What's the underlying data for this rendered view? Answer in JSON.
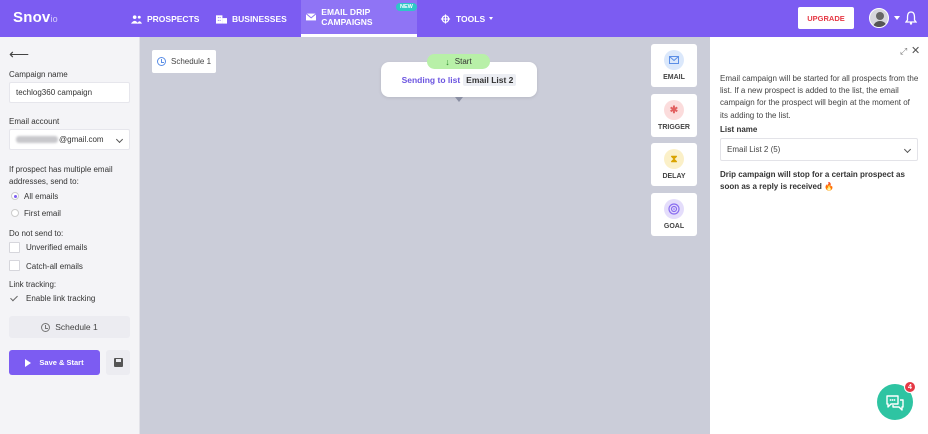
{
  "app": {
    "logo": "Snov",
    "logo_suffix": "io"
  },
  "nav": {
    "items": [
      {
        "label": "PROSPECTS",
        "icon": "people-icon"
      },
      {
        "label": "BUSINESSES",
        "icon": "building-icon"
      },
      {
        "label": "EMAIL DRIP CAMPAIGNS",
        "icon": "envelope-icon",
        "badge": "NEW",
        "active": true
      },
      {
        "label": "TOOLS",
        "icon": "crosshair-icon"
      }
    ],
    "upgrade_label": "UPGRADE"
  },
  "left": {
    "campaign_name_label": "Campaign name",
    "campaign_name_value": "techlog360 campaign",
    "email_account_label": "Email account",
    "email_account_value": "@gmail.com",
    "multiple_label_line1": "If prospect has multiple email",
    "multiple_label_line2": "addresses, send to:",
    "radio_all": "All emails",
    "radio_first": "First email",
    "do_not_send_label": "Do not send to:",
    "check_unverified": "Unverified emails",
    "check_catchall": "Catch-all emails",
    "link_tracking_label": "Link tracking:",
    "check_link_tracking": "Enable link tracking",
    "schedule_label": "Schedule 1",
    "save_start_label": "Save & Start"
  },
  "canvas": {
    "schedule_chip": "Schedule 1",
    "start_label": "Start",
    "sending_label": "Sending to list",
    "list_name": "Email List 2",
    "tools": [
      {
        "label": "EMAIL",
        "icon": "envelope-icon",
        "color": "#dbe8fb"
      },
      {
        "label": "TRIGGER",
        "icon": "trigger-icon",
        "color": "#fbdcdc"
      },
      {
        "label": "DELAY",
        "icon": "hourglass-icon",
        "color": "#fbf0c8"
      },
      {
        "label": "GOAL",
        "icon": "target-icon",
        "color": "#e4ddfb"
      }
    ]
  },
  "right": {
    "description": "Email campaign will be started for all prospects from the list. If a new prospect is added to the list, the email campaign for the prospect will begin at the moment of its adding to the list.",
    "list_name_label": "List name",
    "list_select_value": "Email List 2 (5)",
    "note": "Drip campaign will stop for a certain prospect as soon as a reply is received",
    "note_emoji": "🔥"
  },
  "chat": {
    "badge_count": "4"
  },
  "colors": {
    "brand": "#7c5cf2",
    "upgrade_text": "#e53945",
    "chat": "#2ec4a2",
    "start_green": "#b8f0a8"
  }
}
